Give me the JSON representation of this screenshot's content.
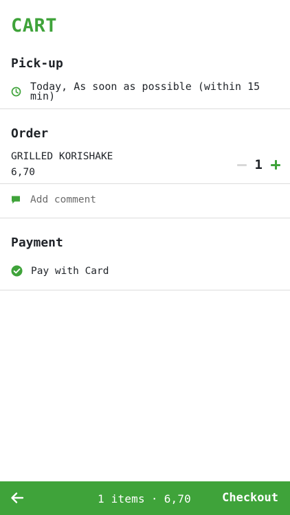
{
  "header": {
    "title": "CART"
  },
  "pickup": {
    "heading": "Pick-up",
    "icon": "clock-icon",
    "time_text": "Today, As soon as possible (within 15 min)"
  },
  "order": {
    "heading": "Order",
    "items": [
      {
        "name": "GRILLED KORISHAKE",
        "price": "6,70",
        "quantity": "1"
      }
    ],
    "comment_placeholder": "Add comment",
    "comment_icon": "comment-icon"
  },
  "payment": {
    "heading": "Payment",
    "method": "Pay with Card",
    "icon": "check-circle-icon"
  },
  "footer": {
    "back_icon": "arrow-left-icon",
    "item_count_label": "1 items",
    "separator": "·",
    "total": "6,70",
    "checkout_label": "Checkout"
  },
  "colors": {
    "accent": "#3fa33a",
    "text": "#1f2328",
    "muted": "#6b6b6b",
    "divider": "#dcdcdc",
    "minus_disabled": "#d8d8d8"
  }
}
